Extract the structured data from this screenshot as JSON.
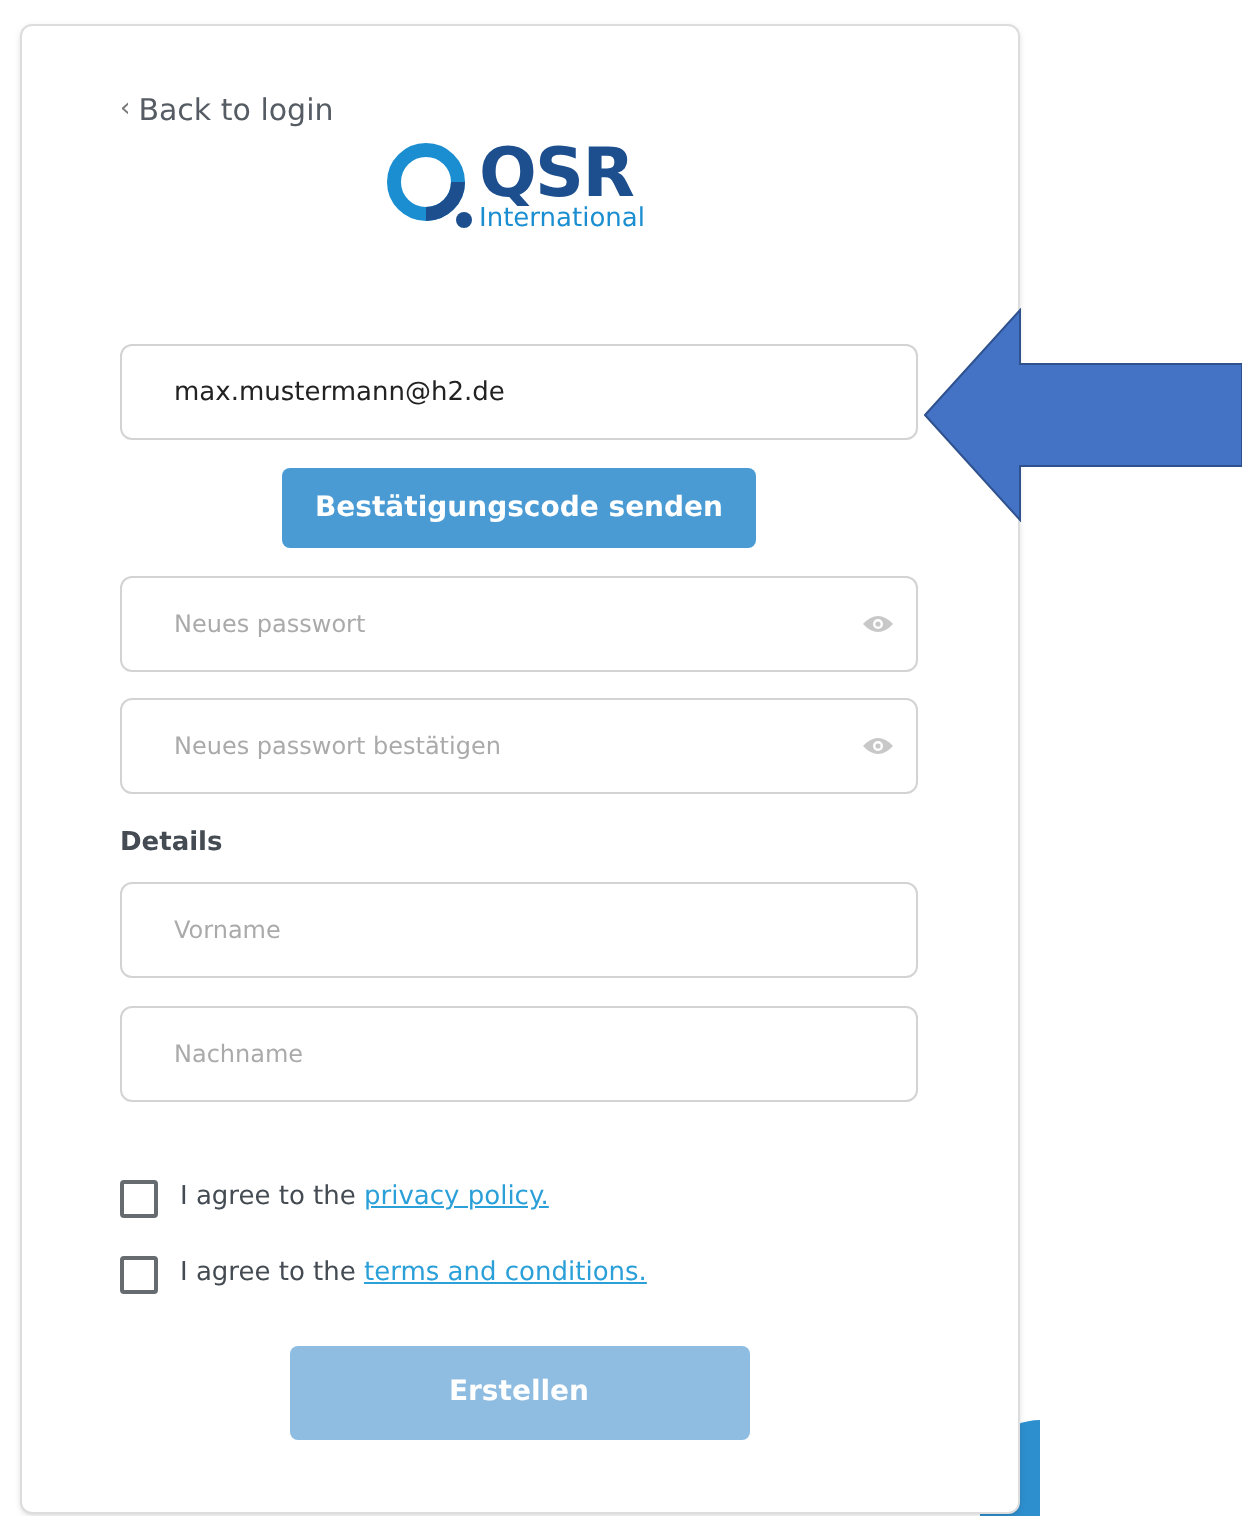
{
  "back_link": {
    "icon": "‹",
    "label": "Back to login"
  },
  "logo": {
    "name": "QSR",
    "tagline": "International"
  },
  "email_field": {
    "value": "max.mustermann@h2.de"
  },
  "send_code_button": {
    "label": "Bestätigungscode senden"
  },
  "password_fields": [
    {
      "placeholder": "Neues passwort"
    },
    {
      "placeholder": "Neues passwort bestätigen"
    }
  ],
  "details_heading": "Details",
  "detail_fields": [
    {
      "placeholder": "Vorname"
    },
    {
      "placeholder": "Nachname"
    }
  ],
  "agreements": [
    {
      "text": "I agree to the ",
      "link": "privacy policy.",
      "checked": false
    },
    {
      "text": "I agree to the ",
      "link": "terms and conditions.",
      "checked": false
    }
  ],
  "submit_button": {
    "label": "Erstellen",
    "disabled": true
  }
}
